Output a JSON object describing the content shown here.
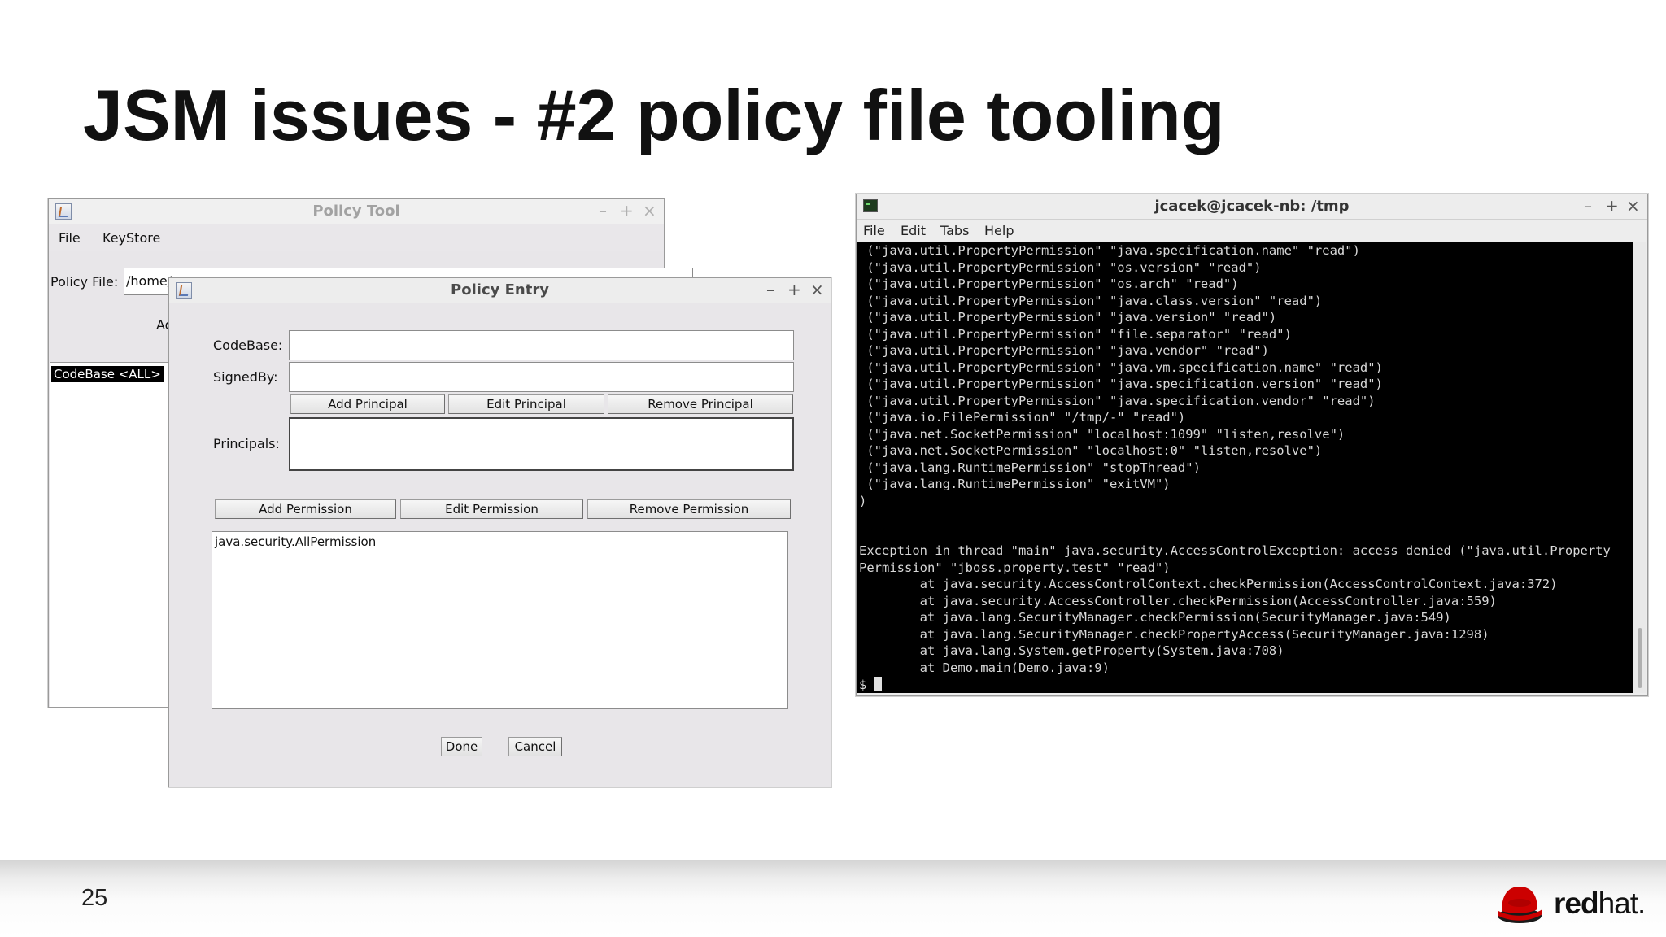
{
  "slide": {
    "title": "JSM issues - #2 policy file tooling",
    "page_number": "25",
    "logo": {
      "bold": "red",
      "light": "hat.",
      "color": "#cc0000"
    }
  },
  "policy_tool": {
    "title": "Policy Tool",
    "menu": [
      "File",
      "KeyStore"
    ],
    "policy_file_label": "Policy File:",
    "policy_file_value": "/home/",
    "add_label": "Ad",
    "selected_entry": "CodeBase <ALL>"
  },
  "policy_entry": {
    "title": "Policy Entry",
    "codebase_label": "CodeBase:",
    "codebase_value": "",
    "signedby_label": "SignedBy:",
    "signedby_value": "",
    "add_principal": "Add Principal",
    "edit_principal": "Edit Principal",
    "remove_principal": "Remove Principal",
    "principals_label": "Principals:",
    "add_permission": "Add Permission",
    "edit_permission": "Edit Permission",
    "remove_permission": "Remove Permission",
    "permissions": [
      "java.security.AllPermission"
    ],
    "done": "Done",
    "cancel": "Cancel"
  },
  "terminal": {
    "title": "jcacek@jcacek-nb: /tmp",
    "menu": [
      "File",
      "Edit",
      "Tabs",
      "Help"
    ],
    "lines": [
      " (\"java.util.PropertyPermission\" \"java.specification.name\" \"read\")",
      " (\"java.util.PropertyPermission\" \"os.version\" \"read\")",
      " (\"java.util.PropertyPermission\" \"os.arch\" \"read\")",
      " (\"java.util.PropertyPermission\" \"java.class.version\" \"read\")",
      " (\"java.util.PropertyPermission\" \"java.version\" \"read\")",
      " (\"java.util.PropertyPermission\" \"file.separator\" \"read\")",
      " (\"java.util.PropertyPermission\" \"java.vendor\" \"read\")",
      " (\"java.util.PropertyPermission\" \"java.vm.specification.name\" \"read\")",
      " (\"java.util.PropertyPermission\" \"java.specification.version\" \"read\")",
      " (\"java.util.PropertyPermission\" \"java.specification.vendor\" \"read\")",
      " (\"java.io.FilePermission\" \"/tmp/-\" \"read\")",
      " (\"java.net.SocketPermission\" \"localhost:1099\" \"listen,resolve\")",
      " (\"java.net.SocketPermission\" \"localhost:0\" \"listen,resolve\")",
      " (\"java.lang.RuntimePermission\" \"stopThread\")",
      " (\"java.lang.RuntimePermission\" \"exitVM\")",
      ")",
      "",
      "",
      "Exception in thread \"main\" java.security.AccessControlException: access denied (\"java.util.Property",
      "Permission\" \"jboss.property.test\" \"read\")",
      "        at java.security.AccessControlContext.checkPermission(AccessControlContext.java:372)",
      "        at java.security.AccessController.checkPermission(AccessController.java:559)",
      "        at java.lang.SecurityManager.checkPermission(SecurityManager.java:549)",
      "        at java.lang.SecurityManager.checkPropertyAccess(SecurityManager.java:1298)",
      "        at java.lang.System.getProperty(System.java:708)",
      "        at Demo.main(Demo.java:9)"
    ],
    "prompt": "$ "
  }
}
